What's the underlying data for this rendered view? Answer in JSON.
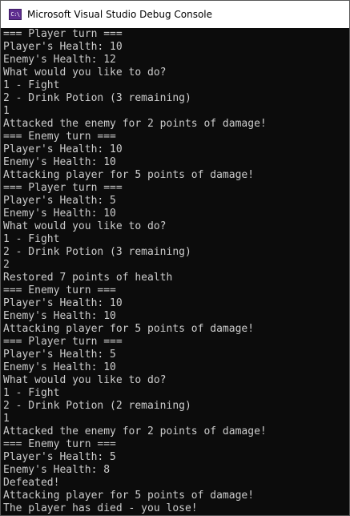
{
  "window": {
    "title": "Microsoft Visual Studio Debug Console",
    "icon_label": "C:\\",
    "icon": "console-app-icon"
  },
  "console": {
    "lines": [
      "=== Player turn ===",
      "Player's Health: 10",
      "Enemy's Health: 12",
      "What would you like to do?",
      "1 - Fight",
      "2 - Drink Potion (3 remaining)",
      "1",
      "Attacked the enemy for 2 points of damage!",
      "=== Enemy turn ===",
      "Player's Health: 10",
      "Enemy's Health: 10",
      "Attacking player for 5 points of damage!",
      "=== Player turn ===",
      "Player's Health: 5",
      "Enemy's Health: 10",
      "What would you like to do?",
      "1 - Fight",
      "2 - Drink Potion (3 remaining)",
      "2",
      "Restored 7 points of health",
      "=== Enemy turn ===",
      "Player's Health: 10",
      "Enemy's Health: 10",
      "Attacking player for 5 points of damage!",
      "=== Player turn ===",
      "Player's Health: 5",
      "Enemy's Health: 10",
      "What would you like to do?",
      "1 - Fight",
      "2 - Drink Potion (2 remaining)",
      "1",
      "Attacked the enemy for 2 points of damage!",
      "=== Enemy turn ===",
      "Player's Health: 5",
      "Enemy's Health: 8",
      "Defeated!",
      "Attacking player for 5 points of damage!",
      "The player has died - you lose!"
    ]
  },
  "colors": {
    "console_background": "#0c0c0c",
    "console_text": "#cccccc",
    "titlebar_background": "#ffffff"
  }
}
